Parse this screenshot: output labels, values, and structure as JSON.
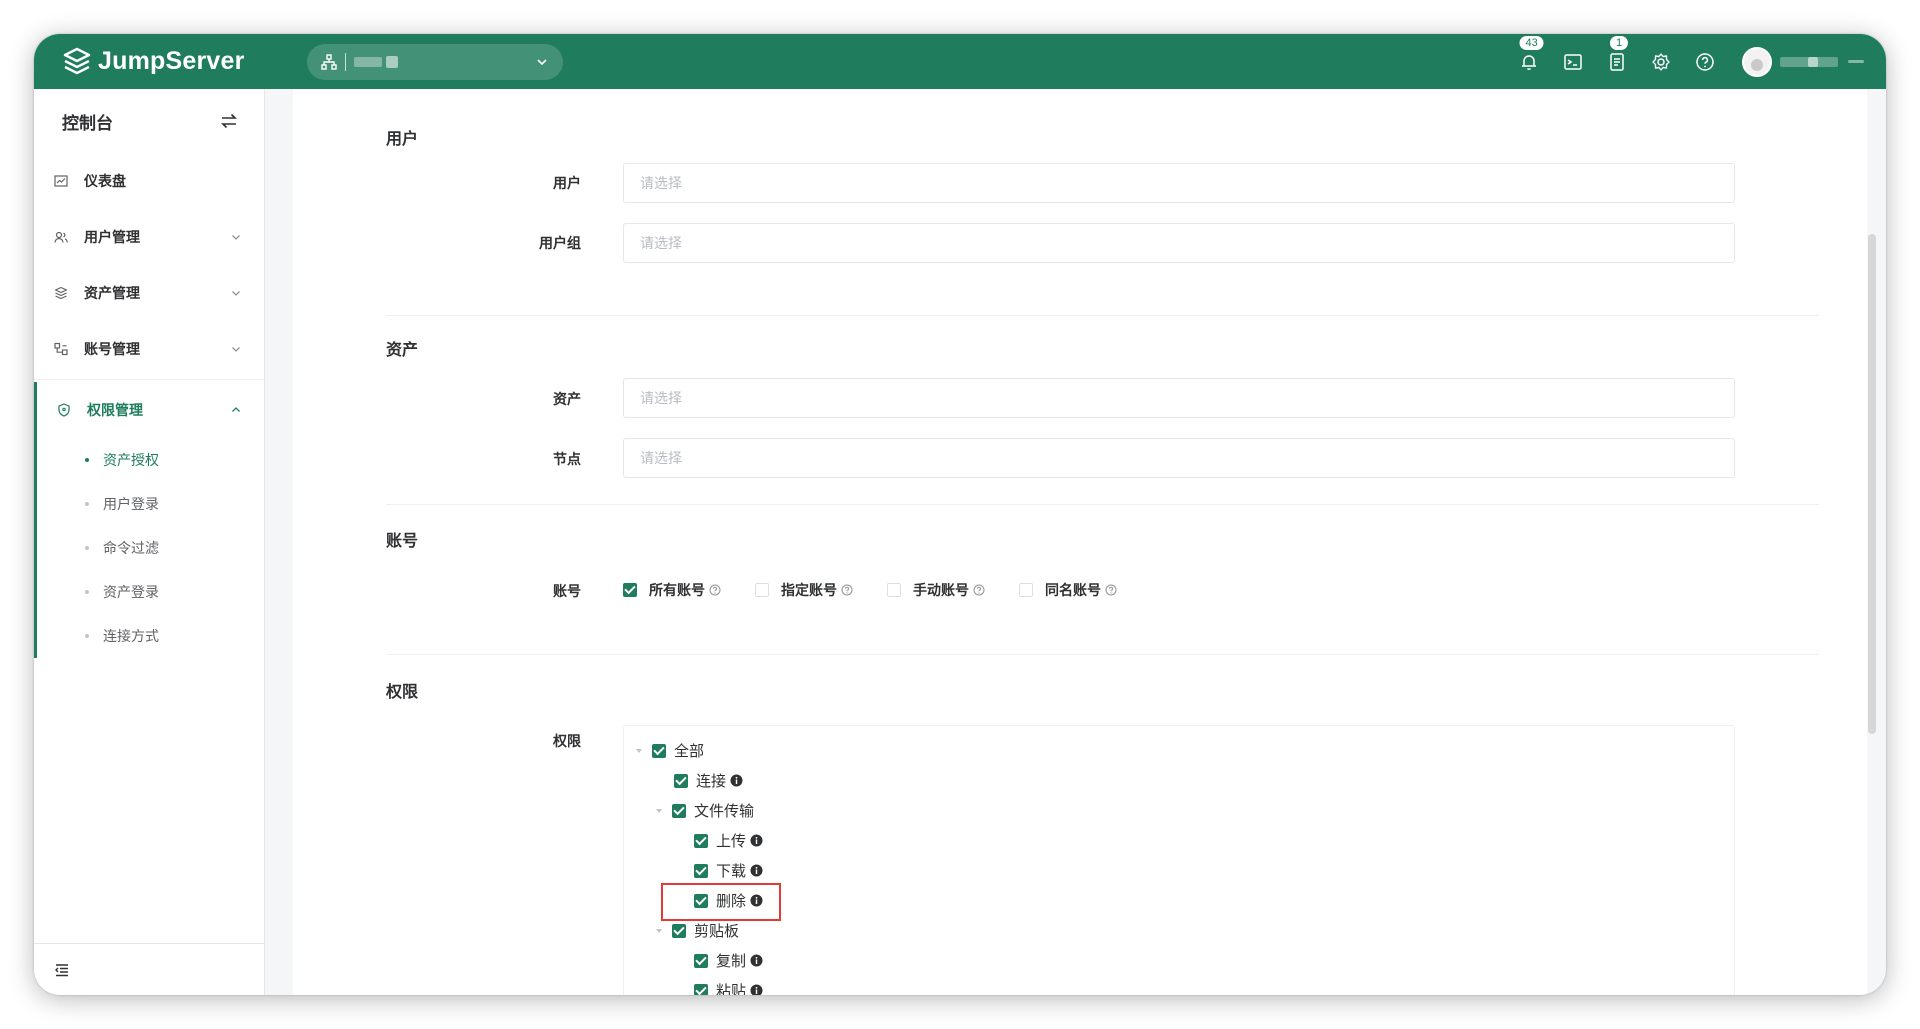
{
  "app": {
    "name": "JumpServer"
  },
  "header": {
    "notifications_count": "43",
    "tickets_count": "1"
  },
  "sidebar": {
    "title": "控制台",
    "items": [
      {
        "label": "仪表盘"
      },
      {
        "label": "用户管理"
      },
      {
        "label": "资产管理"
      },
      {
        "label": "账号管理"
      },
      {
        "label": "权限管理"
      }
    ],
    "sub_items": [
      {
        "label": "资产授权"
      },
      {
        "label": "用户登录"
      },
      {
        "label": "命令过滤"
      },
      {
        "label": "资产登录"
      },
      {
        "label": "连接方式"
      }
    ]
  },
  "form": {
    "section_user": "用户",
    "label_user": "用户",
    "label_user_group": "用户组",
    "section_asset": "资产",
    "label_asset": "资产",
    "label_node": "节点",
    "section_account": "账号",
    "label_account": "账号",
    "section_permission": "权限",
    "label_permission": "权限",
    "placeholder": "请选择",
    "accounts": [
      {
        "label": "所有账号",
        "checked": true
      },
      {
        "label": "指定账号",
        "checked": false
      },
      {
        "label": "手动账号",
        "checked": false
      },
      {
        "label": "同名账号",
        "checked": false
      }
    ],
    "tree": {
      "all": "全部",
      "connect": "连接",
      "file_transfer": "文件传输",
      "upload": "上传",
      "download": "下载",
      "delete": "删除",
      "clipboard": "剪贴板",
      "copy": "复制",
      "paste": "粘贴"
    }
  },
  "colors": {
    "brand": "#1f7c5c",
    "highlight": "#e53935"
  }
}
